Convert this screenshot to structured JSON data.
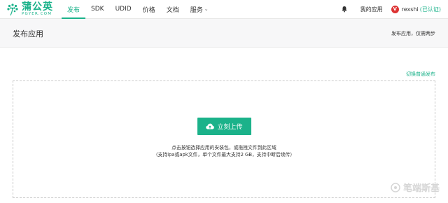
{
  "brand": {
    "name": "蒲公英",
    "sub": "PGYER.COM",
    "color": "#1bb28a"
  },
  "nav": {
    "items": [
      {
        "label": "发布",
        "active": true
      },
      {
        "label": "SDK"
      },
      {
        "label": "UDID"
      },
      {
        "label": "价格"
      },
      {
        "label": "文档"
      },
      {
        "label": "服务",
        "dropdown": true
      }
    ]
  },
  "user": {
    "notifications_icon": "bell-icon",
    "my_apps": "我的应用",
    "avatar_letter": "V",
    "name": "rexshi",
    "status": "(已认证)"
  },
  "page": {
    "title": "发布应用",
    "hint": "发布应用，仅需两步"
  },
  "upload": {
    "switch_link": "切换普通发布",
    "button_label": "立刻上传",
    "button_icon": "cloud-upload-icon",
    "hint_line1": "点击按钮选择应用的安装包，或拖拽文件到此区域",
    "hint_line2": "（支持ipa或apk文件，单个文件最大支持2 GB，支持中断后续传）"
  },
  "watermark": {
    "text": "笔端斯基"
  }
}
